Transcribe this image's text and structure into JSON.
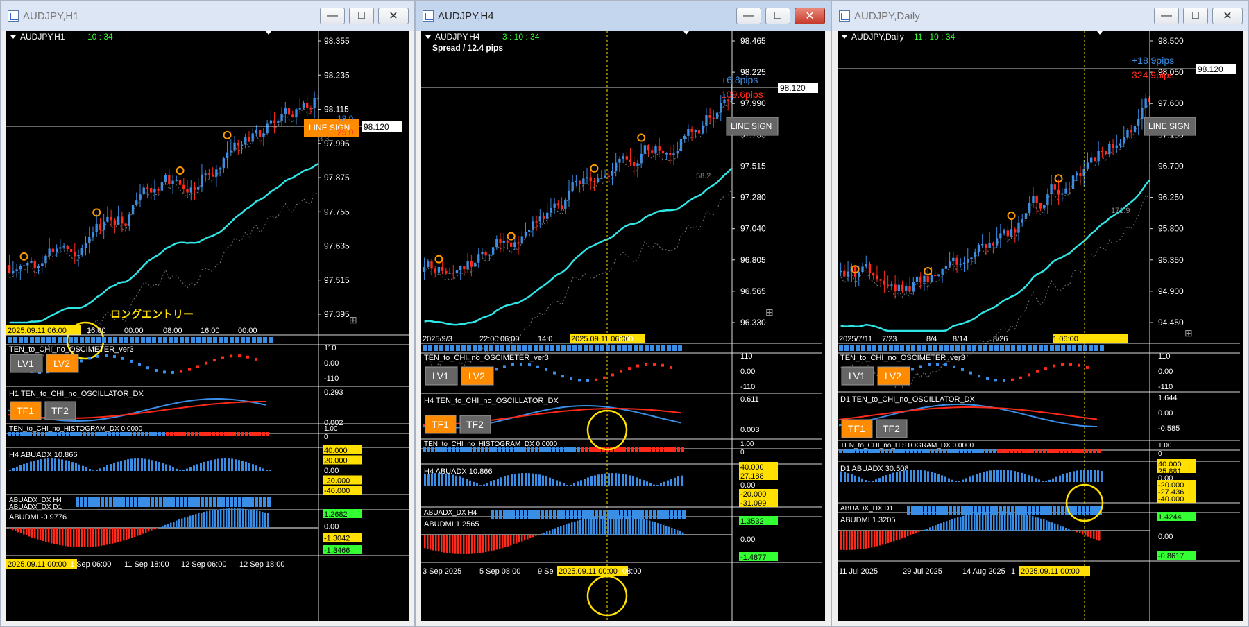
{
  "windows": [
    {
      "title": "AUDJPY,H1",
      "header": {
        "symbol": "AUDJPY,H1",
        "timer": "10 : 34"
      },
      "price_labels": [
        "98.355",
        "98.235",
        "98.115",
        "97.995",
        "97.875",
        "97.755",
        "97.635",
        "97.515",
        "97.395"
      ],
      "current_price": "98.120",
      "line_sign_label": "LINE SIGN",
      "pips_up": "18.9",
      "pips_down": "25.0",
      "indicator_value": "3.3",
      "entry_note": "ロングエントリー",
      "time_labels": [
        "2025.09.11 06:00",
        "16:00",
        "00:00",
        "08:00",
        "16:00",
        "00:00"
      ],
      "sub1": {
        "label": "TEN_to_CHI_no_OSCIMETER_ver3",
        "levels": [
          "110",
          "0.00",
          "-110"
        ],
        "buttons": [
          "LV1",
          "LV2"
        ]
      },
      "sub2": {
        "label": "H1 TEN_to_CHI_no_OSCILLATOR_DX",
        "levels": [
          "0.293",
          "0.002"
        ],
        "buttons": [
          "TF1",
          "TF2"
        ]
      },
      "sub3": {
        "label": "TEN_to_CHI_no_HISTOGRAM_DX 0.0000",
        "levels": [
          "1.00",
          "0"
        ]
      },
      "sub4": {
        "label": "H4 ABUADX 10.866",
        "levels": [
          "40.000",
          "20.000",
          "0.00",
          "-20.000",
          "-40.000"
        ]
      },
      "sub5": {
        "label": "ABUADX_DX H4",
        "label2": "ABUADX_DX D1"
      },
      "sub6": {
        "label": "ABUDMI -0.9776",
        "levels": [
          "1.2682",
          "0.00",
          "-1.3042",
          "-1.3466"
        ]
      },
      "bottom_time_labels": [
        "2025.09.11 00:00",
        "1 Sep 06:00",
        "11 Sep 18:00",
        "12 Sep 06:00",
        "12 Sep 18:00"
      ]
    },
    {
      "title": "AUDJPY,H4",
      "header": {
        "symbol": "AUDJPY,H4",
        "timer": "3 : 10 : 34",
        "spread": "Spread / 12.4 pips"
      },
      "price_labels": [
        "98.465",
        "98.225",
        "97.990",
        "97.755",
        "97.515",
        "97.280",
        "97.040",
        "96.805",
        "96.565",
        "96.330"
      ],
      "current_price": "98.120",
      "line_sign_label": "LINE SIGN",
      "pips_up": "+6.8pips",
      "pips_down": "109.6pips",
      "indicator_value": "58.2",
      "time_labels": [
        "2025/9/3",
        "22:00",
        "06:00",
        "14:0",
        "2025.09.11 06:00",
        "6:00"
      ],
      "sub1": {
        "label": "TEN_to_CHI_no_OSCIMETER_ver3",
        "levels": [
          "110",
          "0.00",
          "-110"
        ],
        "buttons": [
          "LV1",
          "LV2"
        ]
      },
      "sub2": {
        "label": "H4 TEN_to_CHI_no_OSCILLATOR_DX",
        "levels": [
          "0.611",
          "0.003"
        ],
        "buttons": [
          "TF1",
          "TF2"
        ]
      },
      "sub3": {
        "label": "TEN_to_CHI_no_HISTOGRAM_DX 0.0000",
        "levels": [
          "1.00",
          "0"
        ]
      },
      "sub4": {
        "label": "H4 ABUADX 10.866",
        "levels": [
          "40.000",
          "27.188",
          "0.00",
          "-20.000",
          "-31.099"
        ]
      },
      "sub5": {
        "label": "ABUADX_DX H4"
      },
      "sub6": {
        "label": "ABUDMI 1.2565",
        "levels": [
          "1.3532",
          "0.00",
          "-1.4877"
        ]
      },
      "bottom_time_labels": [
        "3 Sep 2025",
        "5 Sep 08:00",
        "9 Se",
        "2025.09.11 00:00",
        "08:00"
      ]
    },
    {
      "title": "AUDJPY,Daily",
      "header": {
        "symbol": "AUDJPY,Daily",
        "timer": "11 : 10 : 34"
      },
      "price_labels": [
        "98.500",
        "98.050",
        "97.600",
        "97.150",
        "96.700",
        "96.250",
        "95.800",
        "95.350",
        "94.900",
        "94.450"
      ],
      "current_price": "98.120",
      "line_sign_label": "LINE SIGN",
      "pips_up": "+18.9pips",
      "pips_down": "324.9pips",
      "indicator_value": "171.9",
      "time_labels": [
        "2025/7/11",
        "7/23",
        "8/4",
        "8/14",
        "8/26",
        "2025.09.11 06:00"
      ],
      "sub1": {
        "label": "TEN_to_CHI_no_OSCIMETER_ver3",
        "levels": [
          "110",
          "0.00",
          "-110"
        ],
        "buttons": [
          "LV1",
          "LV2"
        ]
      },
      "sub2": {
        "label": "D1 TEN_to_CHI_no_OSCILLATOR_DX",
        "levels": [
          "1.644",
          "0.00",
          "-0.585"
        ],
        "buttons": [
          "TF1",
          "TF2"
        ]
      },
      "sub3": {
        "label": "TEN_to_CHI_no_HISTOGRAM_DX 0.0000",
        "levels": [
          "1.00",
          "0"
        ]
      },
      "sub4": {
        "label": "D1 ABUADX 30.508",
        "levels": [
          "40.000",
          "25.881",
          "0.00",
          "-20.000",
          "-27.436",
          "-40.000"
        ]
      },
      "sub5": {
        "label": "ABUADX_DX D1"
      },
      "sub6": {
        "label": "ABUDMI 1.3205",
        "levels": [
          "1.4244",
          "0.00",
          "-0.8617"
        ]
      },
      "bottom_time_labels": [
        "11 Jul 2025",
        "29 Jul 2025",
        "14 Aug 2025",
        "1",
        "2025.09.11 00:00"
      ]
    }
  ],
  "colors": {
    "bull": "#3a8ee6",
    "bear": "#ff2a1a",
    "ma": "#2ee6e6",
    "highlight": "#ffe000",
    "line_sign": "#ff8c00"
  }
}
